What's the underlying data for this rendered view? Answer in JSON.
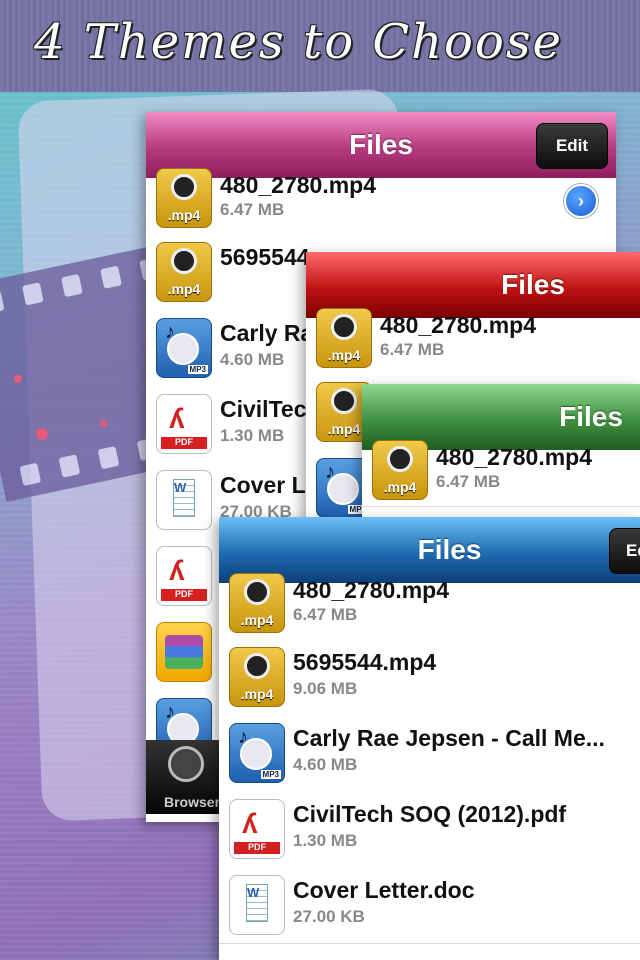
{
  "headline": "4 Themes to Choose",
  "theme_colors": {
    "pink": "#b63a7e",
    "red": "#c01212",
    "green": "#3f9140",
    "blue": "#1f6bb0"
  },
  "panels": {
    "pink": {
      "title": "Files",
      "edit_label": "Edit",
      "rows": [
        {
          "name": "480_2780.mp4",
          "size": "6.47 MB",
          "icon": "video-file-icon"
        },
        {
          "name": "5695544",
          "size": "",
          "icon": "video-file-icon"
        },
        {
          "name": "Carly Ra",
          "size": "4.60 MB",
          "icon": "mp3-file-icon"
        },
        {
          "name": "CivilTech",
          "size": "1.30 MB",
          "icon": "pdf-file-icon"
        },
        {
          "name": "Cover L",
          "size": "27.00 KB",
          "icon": "doc-file-icon"
        },
        {
          "name": "",
          "size": "",
          "icon": "pdf-file-icon"
        },
        {
          "name": "",
          "size": "",
          "icon": "zip-file-icon"
        },
        {
          "name": "",
          "size": "",
          "icon": "mp3-file-icon"
        }
      ],
      "tab_label": "Browser"
    },
    "red": {
      "title": "Files",
      "rows": [
        {
          "name": "480_2780.mp4",
          "size": "6.47 MB",
          "icon": "video-file-icon"
        },
        {
          "name": "",
          "size": "",
          "icon": "video-file-icon"
        },
        {
          "name": "",
          "size": "",
          "icon": "mp3-file-icon"
        }
      ]
    },
    "green": {
      "title": "Files",
      "rows": [
        {
          "name": "480_2780.mp4",
          "size": "6.47 MB",
          "icon": "video-file-icon"
        }
      ]
    },
    "blue": {
      "title": "Files",
      "edit_label": "Ed",
      "rows": [
        {
          "name": "480_2780.mp4",
          "size": "6.47 MB",
          "icon": "video-file-icon"
        },
        {
          "name": "5695544.mp4",
          "size": "9.06 MB",
          "icon": "video-file-icon"
        },
        {
          "name": "Carly Rae Jepsen - Call Me...",
          "size": "4.60 MB",
          "icon": "mp3-file-icon"
        },
        {
          "name": "CivilTech SOQ (2012).pdf",
          "size": "1.30 MB",
          "icon": "pdf-file-icon"
        },
        {
          "name": "Cover Letter.doc",
          "size": "27.00 KB",
          "icon": "doc-file-icon"
        }
      ]
    }
  },
  "icon_labels": {
    "video": ".mp4",
    "mp3": "MP3",
    "pdf": "PDF",
    "doc": "W"
  }
}
